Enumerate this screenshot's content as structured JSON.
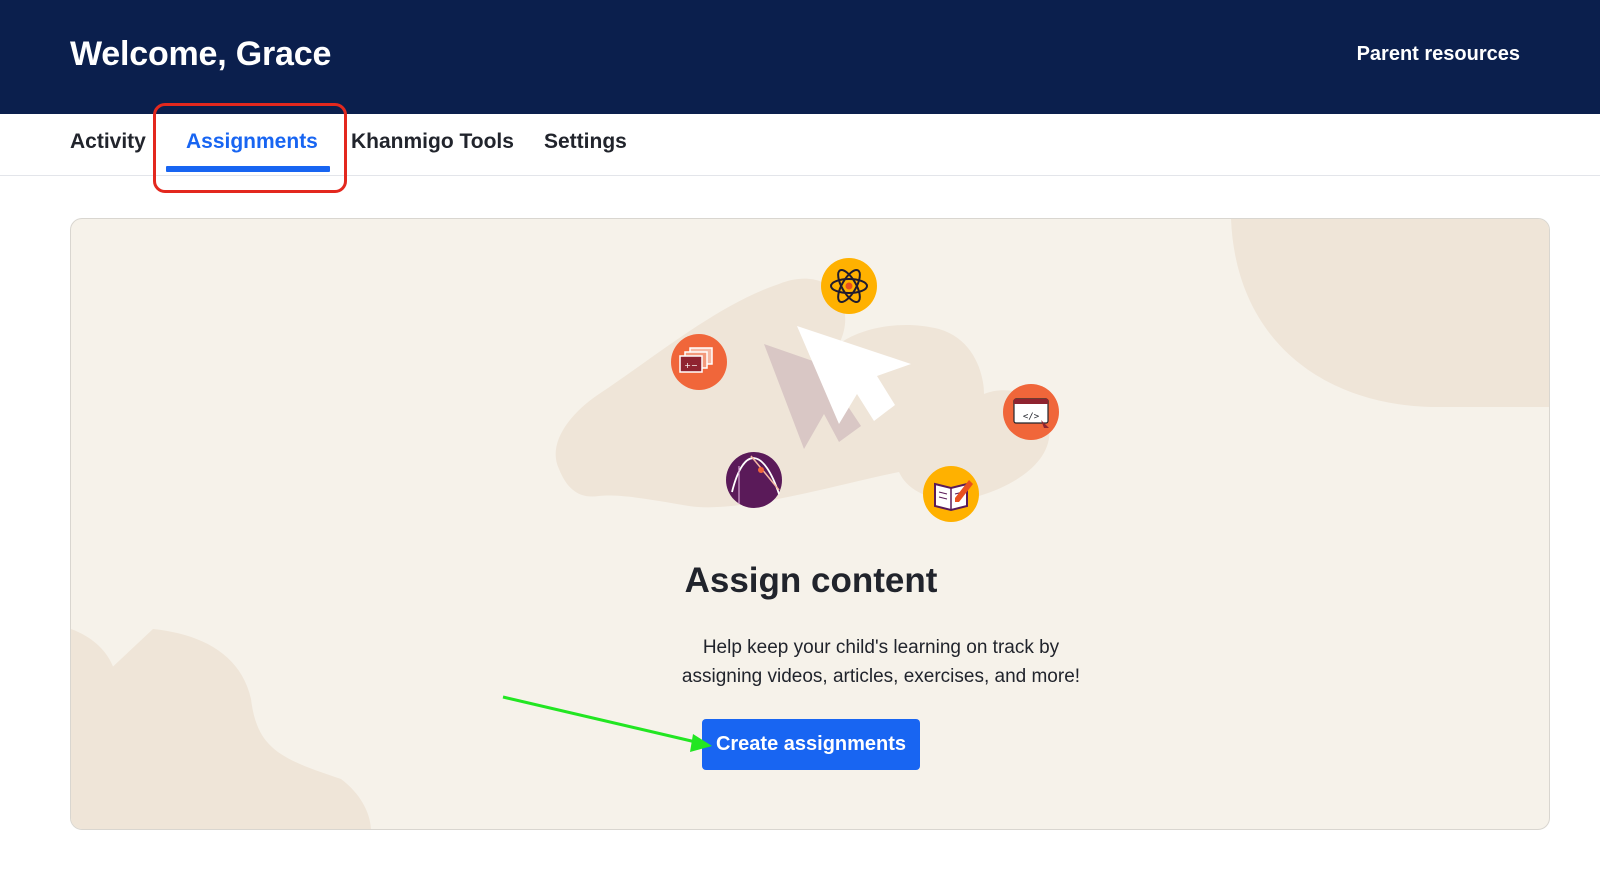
{
  "header": {
    "welcome": "Welcome, Grace",
    "parent_resources": "Parent resources",
    "background_color": "#0b1f4d"
  },
  "tabs": [
    {
      "label": "Activity",
      "active": false
    },
    {
      "label": "Assignments",
      "active": true
    },
    {
      "label": "Khanmigo Tools",
      "active": false
    },
    {
      "label": "Settings",
      "active": false
    }
  ],
  "main": {
    "heading": "Assign content",
    "description": "Help keep your child's learning on track by assigning videos, articles, exercises, and more!",
    "cta_label": "Create assignments"
  },
  "illustration": {
    "icons": [
      "atom-icon",
      "calculator-cards-icon",
      "code-window-icon",
      "graph-icon",
      "book-pencil-icon",
      "pointer-cursor-icon"
    ]
  },
  "annotations": {
    "tab_highlight_color": "#e3281e",
    "arrow_color": "#22e622"
  },
  "colors": {
    "accent": "#1865f2",
    "card_background": "#f6f2ea"
  }
}
